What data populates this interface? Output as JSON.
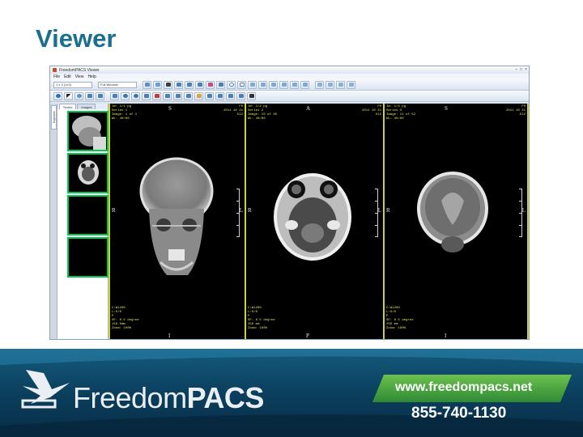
{
  "slide": {
    "title": "Viewer"
  },
  "window": {
    "title": "FreedomPACS Viewer",
    "controls": [
      "–",
      "□",
      "×"
    ],
    "menu": [
      "File",
      "Edit",
      "View",
      "Help"
    ],
    "toolbar": {
      "layout_select": "1 x 3 (1x3)",
      "preset_select": "Full Window"
    }
  },
  "panel": {
    "side_tab": "Explorer",
    "tabs": [
      "Series",
      "Images"
    ]
  },
  "viewports": [
    {
      "orientation": {
        "top": "S",
        "bottom": "I",
        "left": "R",
        "right": "L"
      },
      "overlay_tl": "Im: 1/1 pg\nSeries 1\nImage: 1 of 1\nWL: 40/80",
      "overlay_tr": "FR\n2011 10 21\n512",
      "overlay_bl": "C:W1200\nL:0/0\nP\nSF: 0.5 degree\n150.0mm\nZoom: 100%"
    },
    {
      "orientation": {
        "top": "A",
        "bottom": "P",
        "left": "R",
        "right": "L"
      },
      "overlay_tl": "Im: 1/2 pg\nSeries 2\nImage: 10 of 30\nWL: 40/80",
      "overlay_tr": "FR\n2011 10 21\n512",
      "overlay_bl": "C:W1200\nL:0/0\nP\nSF: 0.5 degree\n250 mm\nZoom: 100%"
    },
    {
      "orientation": {
        "top": "S",
        "bottom": "I",
        "left": "R",
        "right": "L"
      },
      "overlay_tl": "Im: 1/3 pg\nSeries 3\nImage: 11 of 52\nWL: 40/80",
      "overlay_tr": "FR\n2011 10 21\n512",
      "overlay_bl": "C:W1200\nL:0/0\nP\nSF: 0.5 degree\n250 mm\nZoom: 100%"
    }
  ],
  "banner": {
    "brand_light": "Freedom",
    "brand_bold": "PACS",
    "url": "www.freedompacs.net",
    "phone": "855-740-1130"
  },
  "colors": {
    "title": "#1a6f8f",
    "viewport_border": "#c9d23a",
    "thumbnail_border": "#00c84a",
    "overlay_text": "#e7e45a",
    "banner": "#0b3f5e",
    "url_pill": "#3aa53f"
  }
}
